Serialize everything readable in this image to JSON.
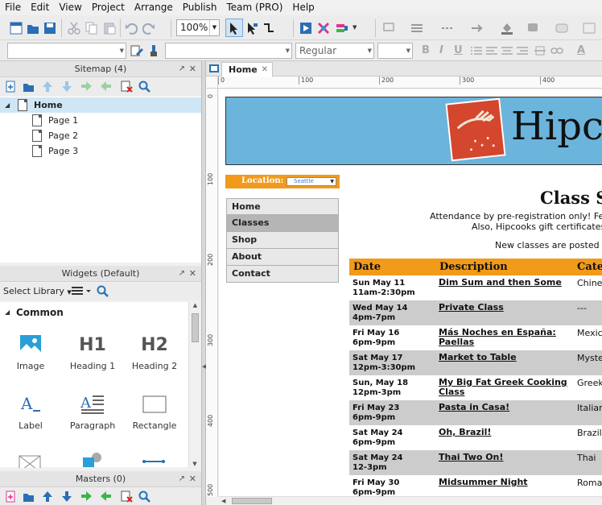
{
  "menu": [
    "File",
    "Edit",
    "View",
    "Project",
    "Arrange",
    "Publish",
    "Team (PRO)",
    "Help"
  ],
  "toolbar": {
    "zoom": "100%",
    "font_style": "Regular"
  },
  "sitemap": {
    "title": "Sitemap (4)",
    "pages": [
      {
        "label": "Home",
        "selected": true
      },
      {
        "label": "Page 1"
      },
      {
        "label": "Page 2"
      },
      {
        "label": "Page 3"
      }
    ]
  },
  "widgets": {
    "title": "Widgets (Default)",
    "select_library": "Select Library",
    "category": "Common",
    "items": [
      {
        "label": "Image",
        "icon": "image-icon"
      },
      {
        "label": "Heading 1",
        "icon": "heading1-icon",
        "glyph": "H1"
      },
      {
        "label": "Heading 2",
        "icon": "heading2-icon",
        "glyph": "H2"
      },
      {
        "label": "Label",
        "icon": "label-icon"
      },
      {
        "label": "Paragraph",
        "icon": "paragraph-icon"
      },
      {
        "label": "Rectangle",
        "icon": "rectangle-icon"
      }
    ]
  },
  "masters": {
    "title": "Masters (0)"
  },
  "canvas": {
    "tab": "Home",
    "ruler_h": [
      "0",
      "100",
      "200",
      "300",
      "400"
    ],
    "ruler_v": [
      "0",
      "100",
      "200",
      "300",
      "400",
      "500"
    ]
  },
  "site": {
    "name": "Hipcooks",
    "location_label": "Location:",
    "location_value": "Seattle",
    "nav": [
      {
        "label": "Home"
      },
      {
        "label": "Classes",
        "active": true
      },
      {
        "label": "Shop"
      },
      {
        "label": "About"
      },
      {
        "label": "Contact"
      }
    ],
    "page_title": "Class S",
    "intro1": "Attendance by pre-registration only! Feel f",
    "intro2": "Also, Hipcooks gift certificates a",
    "intro3": "New classes are posted ar",
    "table_headers": [
      "Date",
      "Description",
      "Cate"
    ],
    "classes": [
      {
        "date": "Sun May 11",
        "time": "11am-2:30pm",
        "desc": "Dim Sum and then Some",
        "cat": "Chines"
      },
      {
        "date": "Wed May 14",
        "time": "4pm-7pm",
        "desc": "Private Class",
        "cat": "---"
      },
      {
        "date": "Fri May 16",
        "time": "6pm-9pm",
        "desc": "Más Noches en España: Paellas",
        "cat": "Mexic"
      },
      {
        "date": "Sat May 17",
        "time": "12pm-3:30pm",
        "desc": "Market to Table",
        "cat": "Myste"
      },
      {
        "date": "Sun, May 18",
        "time": "12pm-3pm",
        "desc": "My Big Fat Greek Cooking Class",
        "cat": "Greek"
      },
      {
        "date": "Fri May 23",
        "time": "6pm-9pm",
        "desc": "Pasta in Casa!",
        "cat": "Italian"
      },
      {
        "date": "Sat May 24",
        "time": "6pm-9pm",
        "desc": "Oh, Brazil!",
        "cat": "Brazil"
      },
      {
        "date": "Sat May 24",
        "time": "12-3pm",
        "desc": "Thai Two On!",
        "cat": "Thai"
      },
      {
        "date": "Fri May 30",
        "time": "6pm-9pm",
        "desc": "Midsummer Night",
        "cat": "Roma"
      }
    ]
  }
}
